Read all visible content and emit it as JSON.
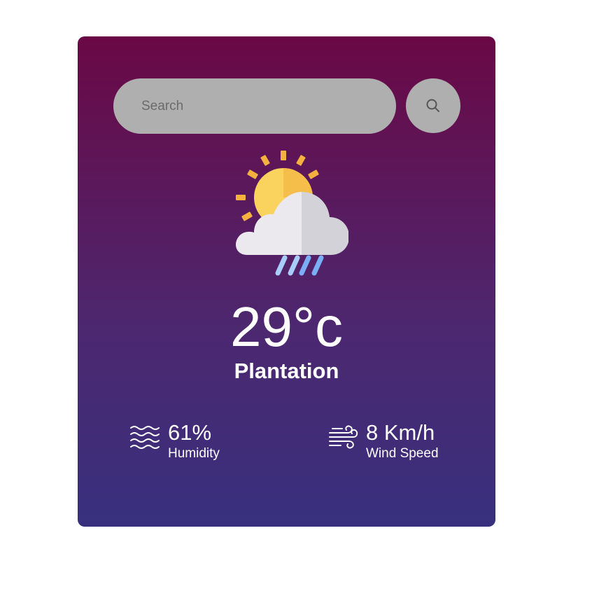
{
  "search": {
    "placeholder": "Search",
    "value": "",
    "button_icon": "search-icon"
  },
  "weather": {
    "icon": "sun-cloud-rain-icon",
    "temperature": "29°c",
    "city": "Plantation"
  },
  "details": {
    "humidity": {
      "icon": "waves-icon",
      "value": "61%",
      "label": "Humidity"
    },
    "wind": {
      "icon": "wind-icon",
      "value": "8 Km/h",
      "label": "Wind Speed"
    }
  },
  "colors": {
    "gradient_top": "#6a0845",
    "gradient_bottom": "#38307e",
    "search_bg": "#afafaf",
    "sun": "#f9c84e",
    "cloud": "#ebe9ee",
    "rain": "#7aaef5"
  }
}
